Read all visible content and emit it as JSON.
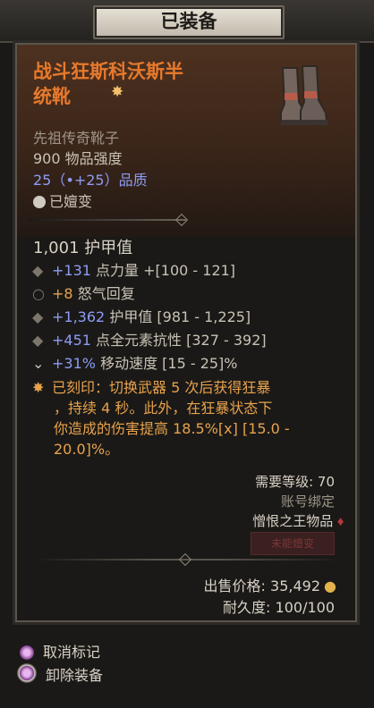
{
  "header": {
    "title": "已装备"
  },
  "item": {
    "name_line1": "战斗狂斯科沃斯半",
    "name_line2": "统靴",
    "type": "先祖传奇靴子",
    "power": "900 物品强度",
    "quality_a": "25（",
    "quality_b": "+25）品质",
    "tempered": "已嬗变",
    "armor": "1,001 护甲值"
  },
  "mods": [
    {
      "value": "+131",
      "text": "点力量 +[100 - 121]"
    },
    {
      "value": "+8",
      "text": "怒气回复"
    },
    {
      "value": "+1,362",
      "text": "护甲值 [981 - 1,225]"
    },
    {
      "value": "+451",
      "text": "点全元素抗性 [327 - 392]"
    },
    {
      "value": "+31%",
      "text": "移动速度 [15 - 25]%"
    }
  ],
  "aspect": {
    "line1": "已刻印：切换武器 5 次后获得狂暴",
    "line2": "，持续 4 秒。此外，在狂暴状态下",
    "line3": "你造成的伤害提高 18.5%[x] [15.0 -",
    "line4": "20.0]%。"
  },
  "requirements": {
    "level": "需要等级: 70",
    "bound": "账号绑定",
    "source": "憎恨之王物品",
    "badge": "未能嬗变"
  },
  "footer": {
    "sell": "出售价格:",
    "sell_value": "35,492",
    "durability": "耐久度: 100/100"
  },
  "actions": {
    "unmark": "取消标记",
    "unequip": "卸除装备"
  },
  "colors": {
    "legendary": "#e7792c",
    "stat": "#8e9cf3",
    "aspect": "#e8a24c"
  }
}
